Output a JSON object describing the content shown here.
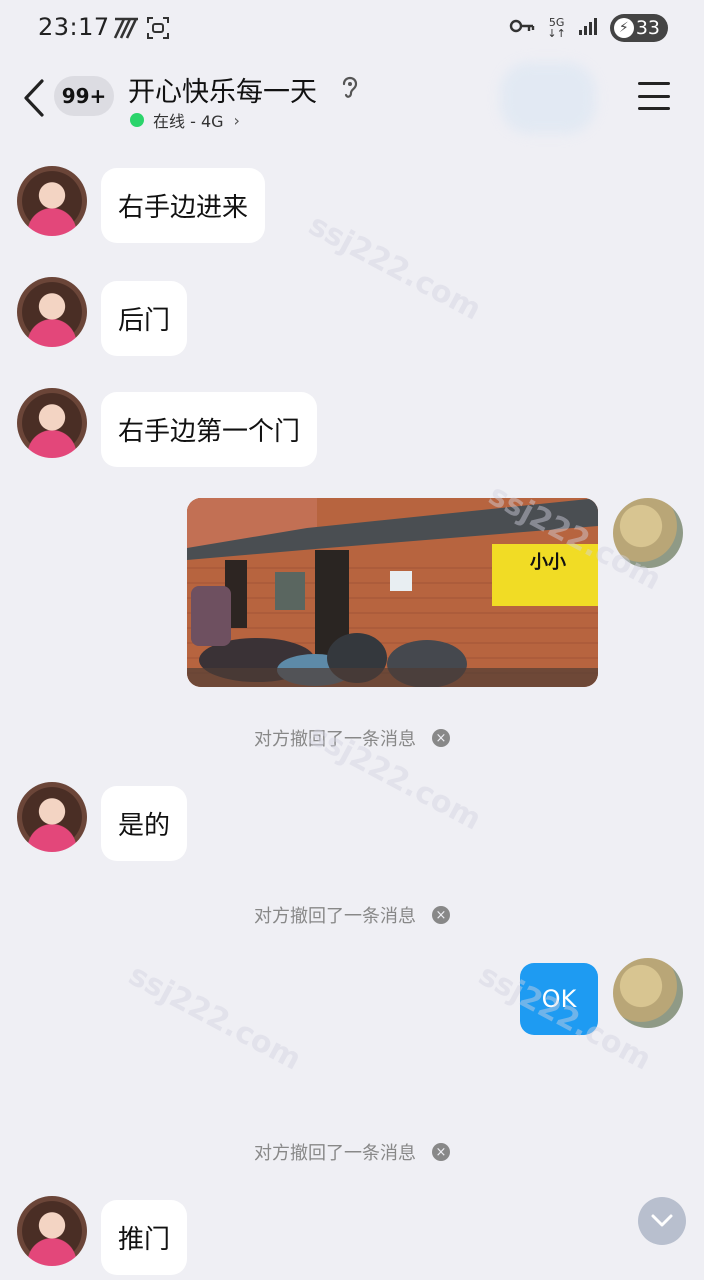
{
  "status_bar": {
    "time": "23:17",
    "network": "5G",
    "battery": "33"
  },
  "header": {
    "unread_count": "99+",
    "title": "开心快乐每一天",
    "status": "在线 - 4G",
    "chevron": "›"
  },
  "messages": [
    {
      "sender": "other",
      "text": "右手边进来"
    },
    {
      "sender": "other",
      "text": "后门"
    },
    {
      "sender": "other",
      "text": "右手边第一个门"
    },
    {
      "sender": "me",
      "type": "image",
      "sign_text": "小小"
    },
    {
      "type": "system",
      "text": "对方撤回了一条消息"
    },
    {
      "sender": "other",
      "text": "是的"
    },
    {
      "type": "system",
      "text": "对方撤回了一条消息"
    },
    {
      "sender": "me",
      "text": "OK"
    },
    {
      "type": "system",
      "text": "对方撤回了一条消息"
    },
    {
      "sender": "other",
      "text": "推门"
    }
  ],
  "watermark": "ssj222.com",
  "colors": {
    "background": "#efeff4",
    "my_bubble": "#1e9bf2",
    "online": "#2bd46b"
  }
}
